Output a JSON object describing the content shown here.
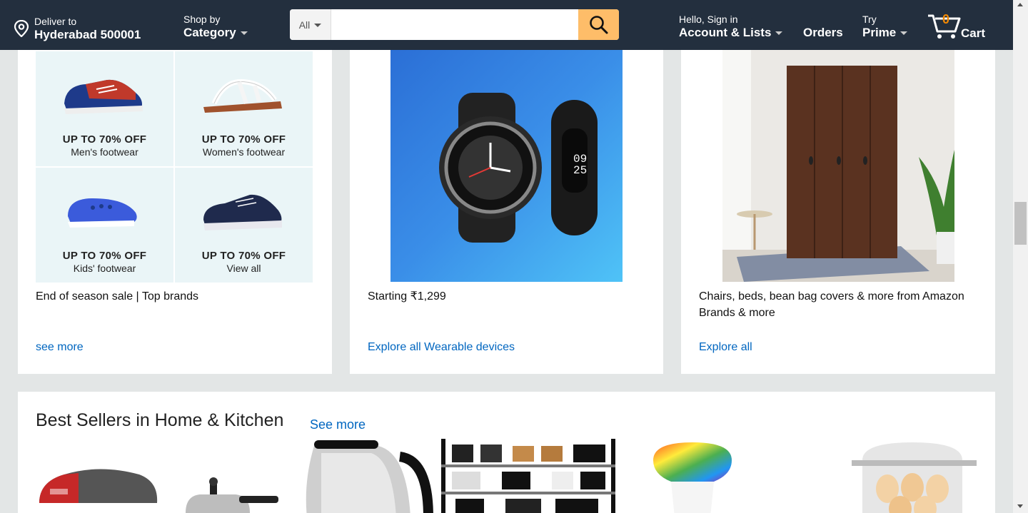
{
  "header": {
    "location_line1": "Deliver to",
    "location_line2": "Hyderabad 500001",
    "category_line1": "Shop by",
    "category_line2": "Category",
    "search_scope": "All",
    "search_placeholder": "",
    "account_line1": "Hello, Sign in",
    "account_line2": "Account & Lists",
    "orders": "Orders",
    "prime_line1": "Try",
    "prime_line2": "Prime",
    "cart_count": "0",
    "cart_label": "Cart",
    "colors": {
      "bg": "#232f3e",
      "search_button": "#febd69",
      "cart_count": "#f08804"
    }
  },
  "cards": [
    {
      "tiles": [
        {
          "offer": "UP TO 70% OFF",
          "label": "Men's footwear"
        },
        {
          "offer": "UP TO 70% OFF",
          "label": "Women's footwear"
        },
        {
          "offer": "UP TO 70% OFF",
          "label": "Kids' footwear"
        },
        {
          "offer": "UP TO 70% OFF",
          "label": "View all"
        }
      ],
      "description": "End of season sale | Top brands",
      "link": "see more"
    },
    {
      "watch_time": [
        "09",
        "25"
      ],
      "description": "Starting ₹1,299",
      "link": "Explore all Wearable devices"
    },
    {
      "description": "Chairs, beds, bean bag covers & more from Amazon Brands & more",
      "link": "Explore all"
    }
  ],
  "best_sellers": {
    "title": "Best Sellers in Home & Kitchen",
    "link": "See more",
    "products": [
      "sandwich-maker",
      "pressure-cooker",
      "electric-kettle",
      "shoe-rack",
      "smart-bulb",
      "egg-boiler"
    ]
  }
}
